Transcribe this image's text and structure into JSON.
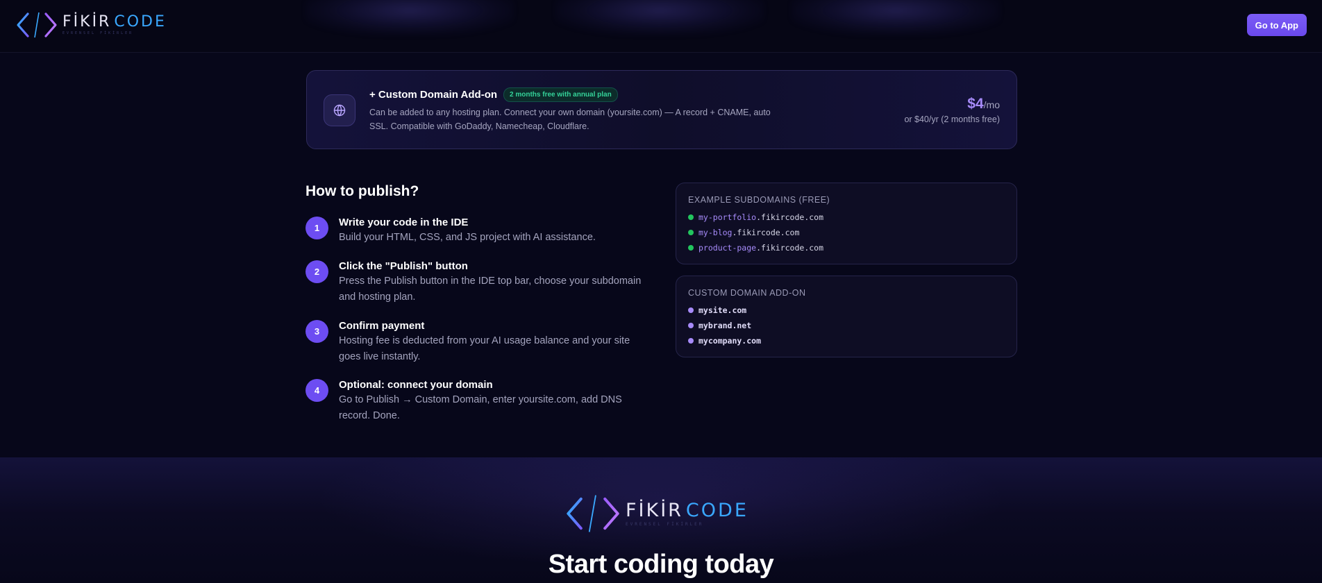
{
  "header": {
    "logo": {
      "word1": "FİKİR",
      "word2": "CODE",
      "tagline": "EVRENSEL FİKİRLER"
    },
    "go_app_label": "Go to App"
  },
  "addon": {
    "icon": "globe-icon",
    "title": "+ Custom Domain Add-on",
    "badge": "2 months free with annual plan",
    "description": "Can be added to any hosting plan. Connect your own domain (yoursite.com) — A record + CNAME, auto SSL. Compatible with GoDaddy, Namecheap, Cloudflare.",
    "price": "$4",
    "price_unit": "/mo",
    "price_sub": "or $40/yr (2 months free)"
  },
  "publish": {
    "heading": "How to publish?",
    "steps": [
      {
        "num": "1",
        "title": "Write your code in the IDE",
        "desc": "Build your HTML, CSS, and JS project with AI assistance."
      },
      {
        "num": "2",
        "title": "Click the \"Publish\" button",
        "desc": "Press the Publish button in the IDE top bar, choose your subdomain and hosting plan."
      },
      {
        "num": "3",
        "title": "Confirm payment",
        "desc": "Hosting fee is deducted from your AI usage balance and your site goes live instantly."
      },
      {
        "num": "4",
        "title": "Optional: connect your domain",
        "desc": "Go to Publish → Custom Domain, enter yoursite.com, add DNS record. Done."
      }
    ]
  },
  "subdomains": {
    "label": "EXAMPLE SUBDOMAINS (FREE)",
    "items": [
      {
        "name": "my-portfolio",
        "domain": ".fikircode.com"
      },
      {
        "name": "my-blog",
        "domain": ".fikircode.com"
      },
      {
        "name": "product-page",
        "domain": ".fikircode.com"
      }
    ]
  },
  "custom_domains": {
    "label": "CUSTOM DOMAIN ADD-ON",
    "items": [
      "mysite.com",
      "mybrand.net",
      "mycompany.com"
    ]
  },
  "cta": {
    "heading": "Start coding today"
  },
  "colors": {
    "accent": "#6d4df2",
    "accent_light": "#a78bfa",
    "success": "#22c55e",
    "background": "#07071a"
  }
}
